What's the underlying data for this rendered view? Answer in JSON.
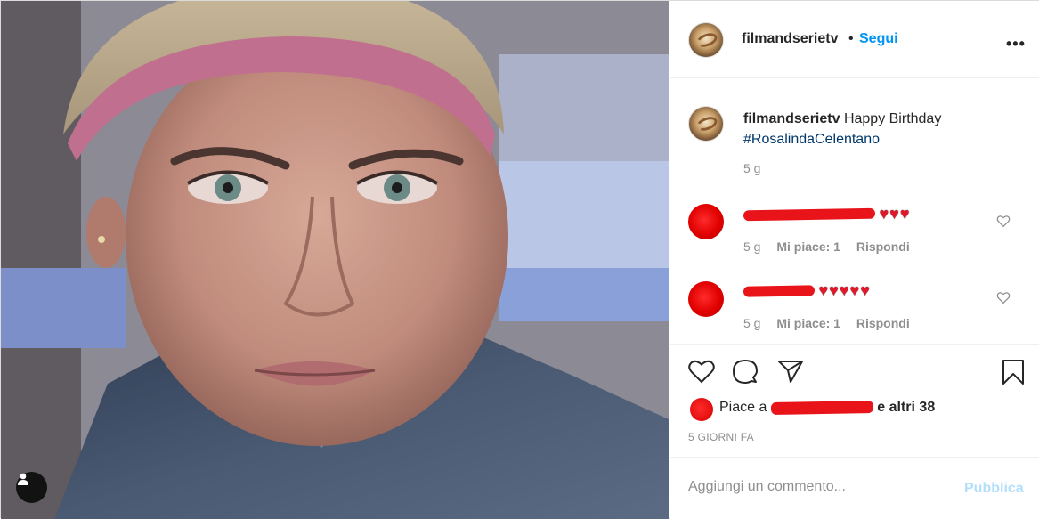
{
  "post": {
    "username": "filmandserietv",
    "dot": "•",
    "follow_label": "Segui",
    "more_label": "•••"
  },
  "caption": {
    "username": "filmandserietv",
    "text": "Happy Birthday",
    "hashtag": "#RosalindaCelentano",
    "time": "5 g"
  },
  "comments": [
    {
      "hearts": "♥♥♥",
      "time": "5 g",
      "likes": "Mi piace: 1",
      "reply": "Rispondi"
    },
    {
      "hearts": "♥♥♥♥♥",
      "time": "5 g",
      "likes": "Mi piace: 1",
      "reply": "Rispondi"
    }
  ],
  "likes": {
    "prefix": "Piace a",
    "suffix": "e altri 38"
  },
  "timestamp": "5 GIORNI FA",
  "add_comment": {
    "placeholder": "Aggiungi un commento...",
    "publish_label": "Pubblica"
  },
  "colors": {
    "link_blue": "#0095f6",
    "hashtag": "#00376b",
    "muted": "#8e8e8e",
    "publish_disabled": "#b2dffc",
    "redaction": "#e8141a"
  }
}
